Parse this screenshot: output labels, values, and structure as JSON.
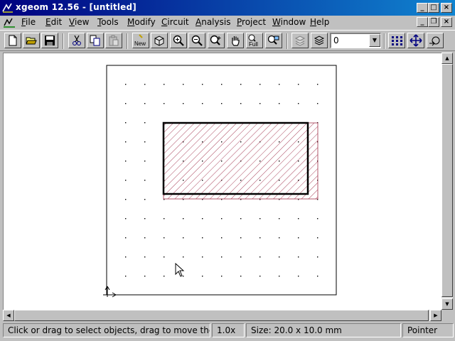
{
  "window": {
    "title": "xgeom 12.56 - [untitled]",
    "controls": {
      "minimize": "_",
      "maximize": "□",
      "close": "×"
    }
  },
  "menu": {
    "items": [
      {
        "label": "File",
        "accel": "F"
      },
      {
        "label": "Edit",
        "accel": "E"
      },
      {
        "label": "View",
        "accel": "V"
      },
      {
        "label": "Tools",
        "accel": "T"
      },
      {
        "label": "Modify",
        "accel": "M"
      },
      {
        "label": "Circuit",
        "accel": "C"
      },
      {
        "label": "Analysis",
        "accel": "A"
      },
      {
        "label": "Project",
        "accel": "P"
      },
      {
        "label": "Window",
        "accel": "W"
      },
      {
        "label": "Help",
        "accel": "H"
      }
    ],
    "doc_controls": {
      "minimize": "_",
      "restore": "❐",
      "close": "×"
    }
  },
  "toolbar": {
    "buttons": [
      {
        "name": "new-file-icon"
      },
      {
        "name": "open-folder-icon"
      },
      {
        "name": "save-icon"
      },
      {
        "name": "cut-icon"
      },
      {
        "name": "copy-icon"
      },
      {
        "name": "paste-icon",
        "disabled": true
      },
      {
        "name": "new-view-icon",
        "label": "New"
      },
      {
        "name": "3d-view-icon"
      },
      {
        "name": "zoom-in-icon"
      },
      {
        "name": "zoom-out-icon"
      },
      {
        "name": "zoom-window-icon"
      },
      {
        "name": "pan-hand-icon"
      },
      {
        "name": "zoom-full-icon",
        "label": "Full"
      },
      {
        "name": "zoom-objects-icon"
      },
      {
        "name": "layer-mesh-icon",
        "disabled": true
      },
      {
        "name": "layer-stack-icon"
      },
      {
        "name": "snap-grid-icon"
      },
      {
        "name": "move-arrows-icon"
      },
      {
        "name": "rotate-copy-icon"
      }
    ],
    "layer_select": {
      "value": "0"
    }
  },
  "canvas": {
    "grid_color": "#000000",
    "selection_rect_color": "#000000",
    "hatch_color": "#a0304a"
  },
  "status": {
    "hint": "Click or drag to select objects, drag to move them",
    "zoom": "1.0x",
    "size": "Size: 20.0 x 10.0 mm",
    "mode": "Pointer"
  }
}
